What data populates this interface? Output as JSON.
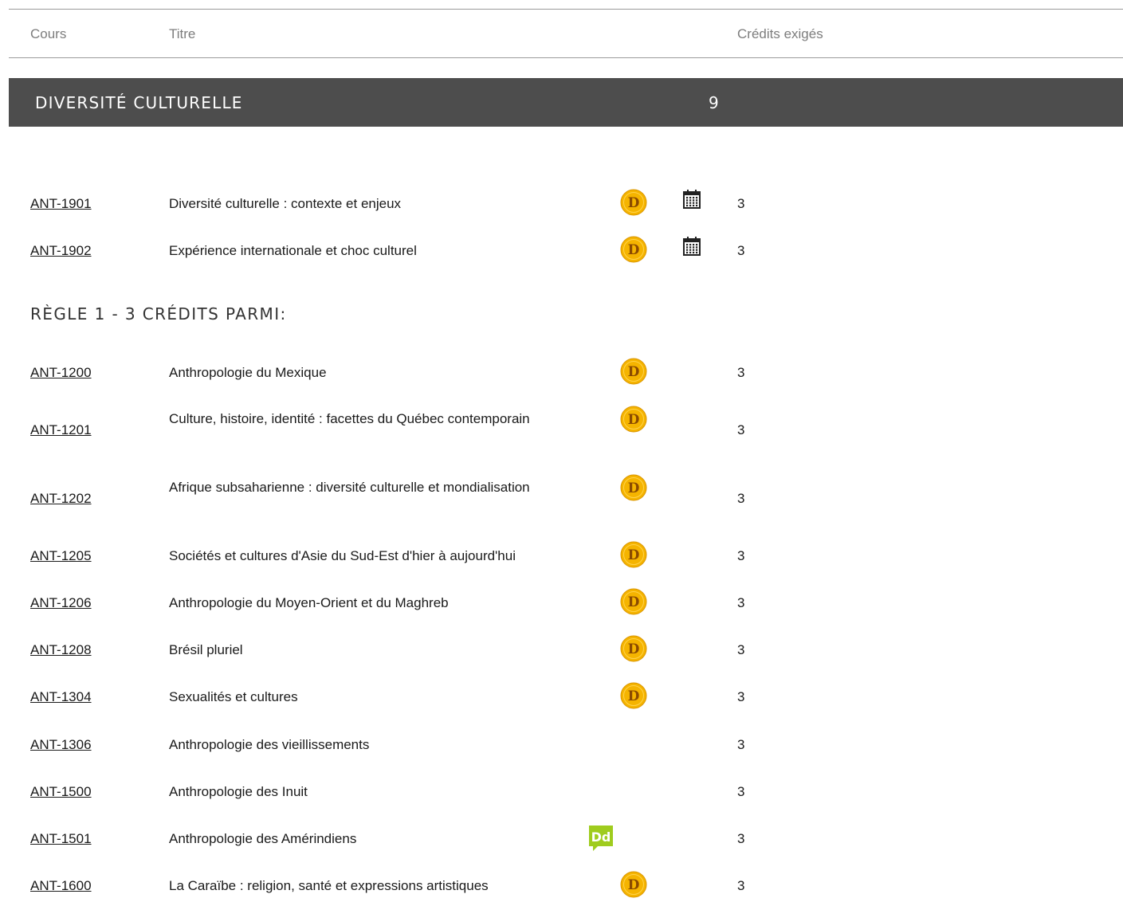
{
  "header": {
    "col_course": "Cours",
    "col_title": "Titre",
    "col_credits": "Crédits exigés"
  },
  "section": {
    "title": "DIVERSITÉ CULTURELLE",
    "credits": "9"
  },
  "required_courses": [
    {
      "code": "ANT-1901",
      "title": "Diversité culturelle : contexte et enjeux",
      "credits": "3",
      "badge": "d-coin-icon",
      "calendar": true
    },
    {
      "code": "ANT-1902",
      "title": "Expérience internationale et choc culturel",
      "credits": "3",
      "badge": "d-coin-icon",
      "calendar": true
    }
  ],
  "rule": {
    "title": "RÈGLE 1 - 3 CRÉDITS PARMI:"
  },
  "rule_courses": [
    {
      "code": "ANT-1200",
      "title": "Anthropologie du Mexique",
      "credits": "3",
      "badge": "d-coin-icon"
    },
    {
      "code": "ANT-1201",
      "title": "Culture, histoire, identité : facettes du Québec contemporain",
      "credits": "3",
      "badge": "d-coin-icon"
    },
    {
      "code": "ANT-1202",
      "title": "Afrique subsaharienne : diversité culturelle et mondialisation",
      "credits": "3",
      "badge": "d-coin-icon"
    },
    {
      "code": "ANT-1205",
      "title": "Sociétés et cultures d'Asie du Sud-Est d'hier à aujourd'hui",
      "credits": "3",
      "badge": "d-coin-icon"
    },
    {
      "code": "ANT-1206",
      "title": "Anthropologie du Moyen-Orient et du Maghreb",
      "credits": "3",
      "badge": "d-coin-icon"
    },
    {
      "code": "ANT-1208",
      "title": "Brésil pluriel",
      "credits": "3",
      "badge": "d-coin-icon"
    },
    {
      "code": "ANT-1304",
      "title": "Sexualités et cultures",
      "credits": "3",
      "badge": "d-coin-icon"
    },
    {
      "code": "ANT-1306",
      "title": "Anthropologie des vieillissements",
      "credits": "3",
      "badge": ""
    },
    {
      "code": "ANT-1500",
      "title": "Anthropologie des Inuit",
      "credits": "3",
      "badge": ""
    },
    {
      "code": "ANT-1501",
      "title": "Anthropologie des Amérindiens",
      "credits": "3",
      "badge": "dd-green-icon"
    },
    {
      "code": "ANT-1600",
      "title": "La Caraïbe : religion, santé et expressions artistiques",
      "credits": "3",
      "badge": "d-coin-icon"
    }
  ],
  "colors": {
    "section_bar": "#4d4d4d",
    "coin": "#f5b400",
    "coin_letter": "#8a4a00",
    "dd_badge": "#9fcc1e"
  }
}
